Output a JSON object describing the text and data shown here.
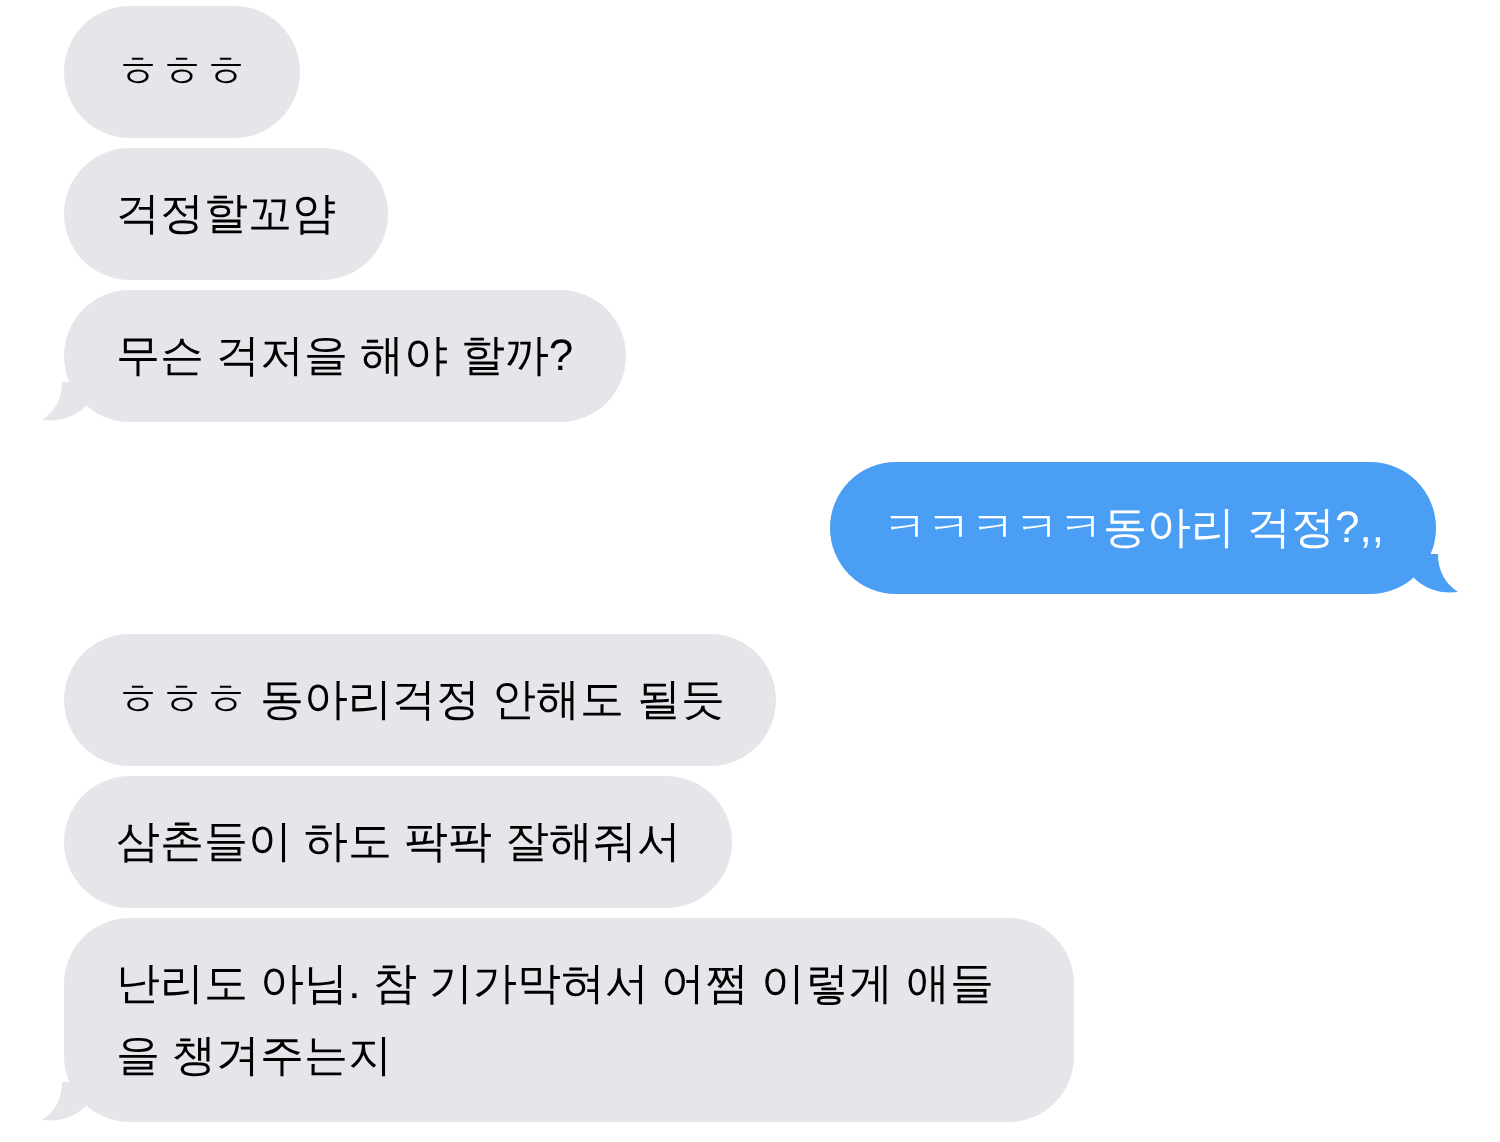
{
  "messages": [
    {
      "kind": "incoming",
      "text": "ㅎㅎㅎ",
      "tail": false
    },
    {
      "kind": "incoming",
      "text": "걱정할꼬얌",
      "tail": false
    },
    {
      "kind": "incoming",
      "text": "무슨 걱저을 해야 할까?",
      "tail": true
    },
    {
      "kind": "outgoing",
      "text": "ㅋㅋㅋㅋㅋ동아리 걱정?,,",
      "tail": true
    },
    {
      "kind": "incoming",
      "text": "ㅎㅎㅎ 동아리걱정 안해도 될듯",
      "tail": false
    },
    {
      "kind": "incoming",
      "text": "삼촌들이 하도 팍팍 잘해줘서",
      "tail": false
    },
    {
      "kind": "incoming",
      "text": "난리도 아님. 참 기가막혀서 어쩜 이렇게 애들을 챙겨주는지",
      "tail": true
    }
  ]
}
